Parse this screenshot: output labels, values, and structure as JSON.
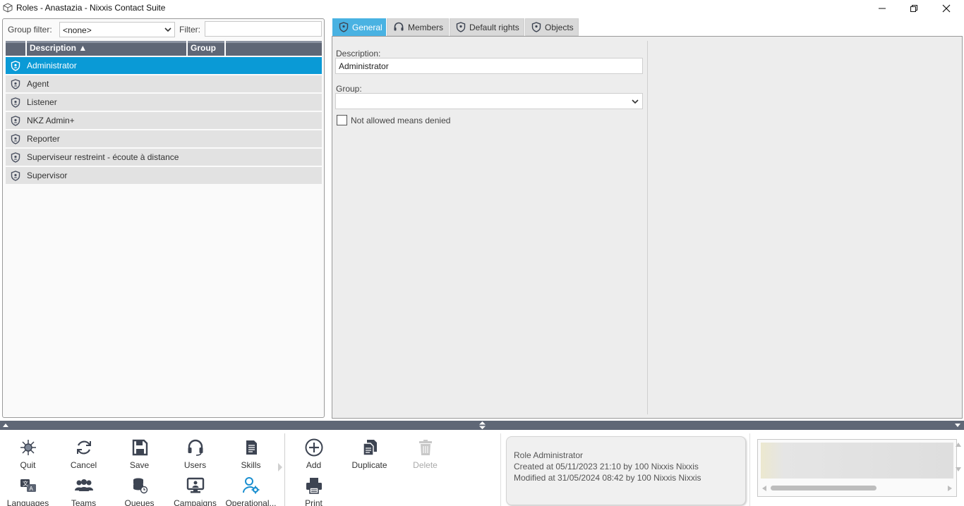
{
  "window": {
    "title": "Roles - Anastazia - Nixxis Contact Suite"
  },
  "left": {
    "group_filter_label": "Group filter:",
    "group_filter_value": "<none>",
    "filter_label": "Filter:",
    "filter_value": "",
    "columns": [
      "Description ▲",
      "Group"
    ],
    "rows": [
      {
        "description": "Administrator",
        "group": "",
        "selected": true
      },
      {
        "description": "Agent",
        "group": ""
      },
      {
        "description": "Listener",
        "group": ""
      },
      {
        "description": "NKZ Admin+",
        "group": ""
      },
      {
        "description": "Reporter",
        "group": ""
      },
      {
        "description": "Superviseur restreint - écoute à distance",
        "group": ""
      },
      {
        "description": "Supervisor",
        "group": ""
      }
    ]
  },
  "tabs": [
    {
      "label": "General",
      "icon": "shield-icon",
      "active": true
    },
    {
      "label": "Members",
      "icon": "headset-icon"
    },
    {
      "label": "Default rights",
      "icon": "shield-icon"
    },
    {
      "label": "Objects",
      "icon": "shield-icon"
    }
  ],
  "general": {
    "description_label": "Description:",
    "description_value": "Administrator",
    "group_label": "Group:",
    "group_value": "",
    "checkbox_label": "Not allowed means denied",
    "checkbox_checked": false
  },
  "toolbar": {
    "nav": [
      {
        "label": "Quit",
        "icon": "quit-icon"
      },
      {
        "label": "Cancel",
        "icon": "refresh-icon"
      },
      {
        "label": "Save",
        "icon": "save-icon"
      },
      {
        "label": "Users",
        "icon": "headset-icon"
      },
      {
        "label": "Skills",
        "icon": "skills-icon"
      },
      {
        "label": "Languages",
        "icon": "languages-icon"
      },
      {
        "label": "Teams",
        "icon": "teams-icon"
      },
      {
        "label": "Queues",
        "icon": "queues-icon"
      },
      {
        "label": "Campaigns",
        "icon": "campaigns-icon"
      },
      {
        "label": "Operational...",
        "icon": "operational-icon"
      }
    ],
    "actions": [
      {
        "label": "Add",
        "icon": "add-icon",
        "enabled": true
      },
      {
        "label": "Duplicate",
        "icon": "duplicate-icon",
        "enabled": true
      },
      {
        "label": "Delete",
        "icon": "trash-icon",
        "enabled": false
      },
      {
        "label": "Print",
        "icon": "printer-icon",
        "enabled": true
      }
    ]
  },
  "info": {
    "title": "Role Administrator",
    "created": "Created at 05/11/2023 21:10 by 100 Nixxis Nixxis",
    "modified": "Modified at 31/05/2024 08:42 by 100 Nixxis Nixxis"
  },
  "colors": {
    "accent": "#0a9ad6",
    "tab_active": "#49b2e2",
    "header": "#5f6776",
    "operational_icon": "#1a8fd0"
  }
}
